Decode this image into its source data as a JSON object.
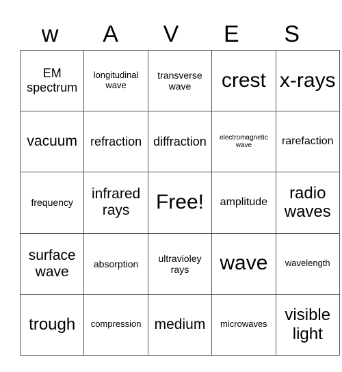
{
  "title_letters": [
    "w",
    "A",
    "V",
    "E",
    "S"
  ],
  "grid": [
    [
      "EM spectrum",
      "longitudinal wave",
      "transverse wave",
      "crest",
      "x-rays"
    ],
    [
      "vacuum",
      "refraction",
      "diffraction",
      "electromagnetic wave",
      "rarefaction"
    ],
    [
      "frequency",
      "infrared rays",
      "Free!",
      "amplitude",
      "radio waves"
    ],
    [
      "surface wave",
      "absorption",
      "ultravioley rays",
      "wave",
      "wavelength"
    ],
    [
      "trough",
      "compression",
      "medium",
      "microwaves",
      "visible light"
    ]
  ],
  "colors": {
    "border": "#555555",
    "text": "#000000",
    "background": "#ffffff"
  }
}
